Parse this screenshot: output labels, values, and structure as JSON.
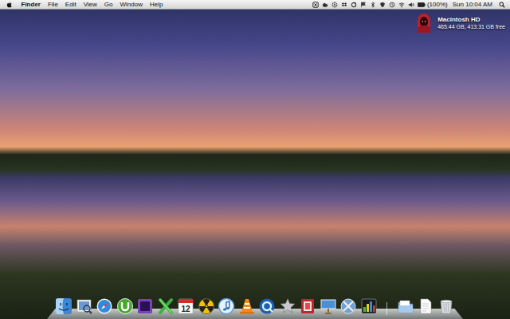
{
  "menu_bar": {
    "app": "Finder",
    "menus": [
      "File",
      "Edit",
      "View",
      "Go",
      "Window",
      "Help"
    ],
    "battery": "(100%)",
    "clock": "Sun 10:04 AM"
  },
  "desktop_items": [
    {
      "label": "Macintosh HD",
      "info": "465.44 GB, 413.31 GB free"
    }
  ],
  "dock": {
    "calendar_day": "12"
  }
}
